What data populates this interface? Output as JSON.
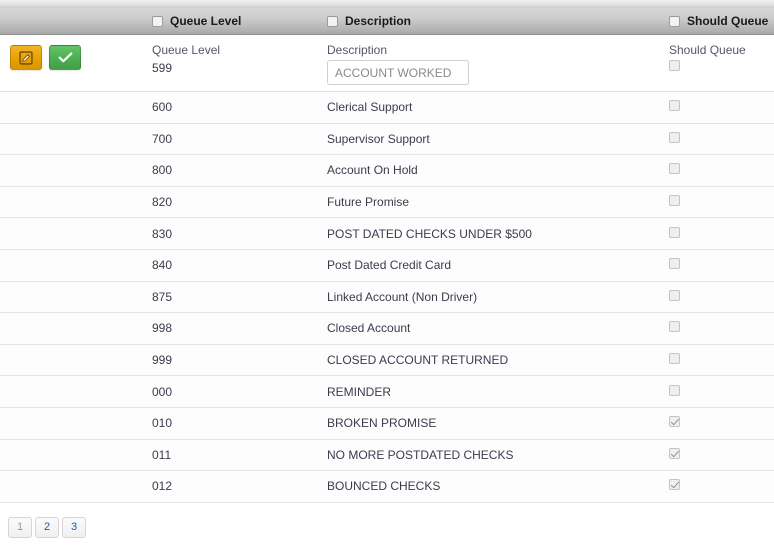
{
  "grid": {
    "columns": [
      {
        "key": "actions",
        "label": ""
      },
      {
        "key": "queue",
        "label": "Queue Level"
      },
      {
        "key": "desc",
        "label": "Description"
      },
      {
        "key": "should",
        "label": "Should Queue"
      }
    ],
    "edit_row": {
      "edit_button_icon": "edit-pencil-icon",
      "accept_button_icon": "checkmark-icon",
      "queue_level_label": "Queue Level",
      "queue_level_value": "599",
      "description_label": "Description",
      "description_value": "ACCOUNT WORKED",
      "description_placeholder": "ACCOUNT WORKED",
      "should_queue_label": "Should Queue",
      "should_queue_checked": false
    },
    "rows": [
      {
        "queue": "600",
        "desc": "Clerical Support",
        "should_queue": false
      },
      {
        "queue": "700",
        "desc": "Supervisor Support",
        "should_queue": false
      },
      {
        "queue": "800",
        "desc": "Account On Hold",
        "should_queue": false
      },
      {
        "queue": "820",
        "desc": "Future Promise",
        "should_queue": false
      },
      {
        "queue": "830",
        "desc": "POST DATED CHECKS UNDER $500",
        "should_queue": false
      },
      {
        "queue": "840",
        "desc": "Post Dated Credit Card",
        "should_queue": false
      },
      {
        "queue": "875",
        "desc": "Linked Account (Non Driver)",
        "should_queue": false
      },
      {
        "queue": "998",
        "desc": "Closed Account",
        "should_queue": false
      },
      {
        "queue": "999",
        "desc": "CLOSED ACCOUNT RETURNED",
        "should_queue": false
      },
      {
        "queue": "000",
        "desc": "REMINDER",
        "should_queue": false
      },
      {
        "queue": "010",
        "desc": "BROKEN PROMISE",
        "should_queue": true
      },
      {
        "queue": "011",
        "desc": "NO MORE POSTDATED CHECKS",
        "should_queue": true
      },
      {
        "queue": "012",
        "desc": "BOUNCED CHECKS",
        "should_queue": true
      }
    ]
  },
  "pagination": {
    "pages": [
      "1",
      "2",
      "3"
    ],
    "current": "1"
  },
  "colors": {
    "edit_button": "#e9a100",
    "accept_button": "#4caf50",
    "header_bar": "#bfbfbf",
    "link": "#1e5fa8"
  }
}
